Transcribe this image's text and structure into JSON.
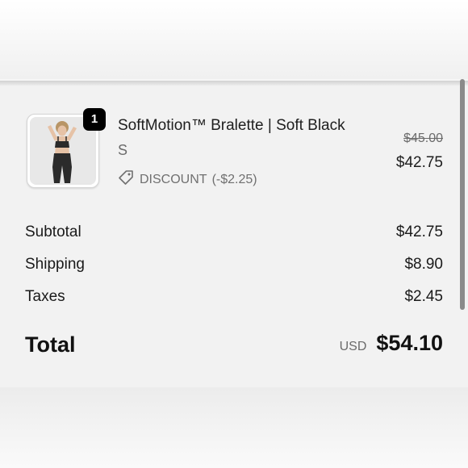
{
  "line_item": {
    "quantity_badge": "1",
    "name": "SoftMotion™ Bralette | Soft Black",
    "variant": "S",
    "discount_label": "DISCOUNT",
    "discount_amount": "(-$2.25)",
    "original_price": "$45.00",
    "price": "$42.75",
    "image_icon": "product-photo"
  },
  "summary": {
    "subtotal_label": "Subtotal",
    "subtotal_value": "$42.75",
    "shipping_label": "Shipping",
    "shipping_value": "$8.90",
    "taxes_label": "Taxes",
    "taxes_value": "$2.45"
  },
  "total": {
    "label": "Total",
    "currency": "USD",
    "value": "$54.10"
  },
  "colors": {
    "badge_bg": "#000000",
    "text_primary": "#1e1e1e",
    "text_muted": "#6b6b6b",
    "panel_bg": "#f2f2f2"
  }
}
